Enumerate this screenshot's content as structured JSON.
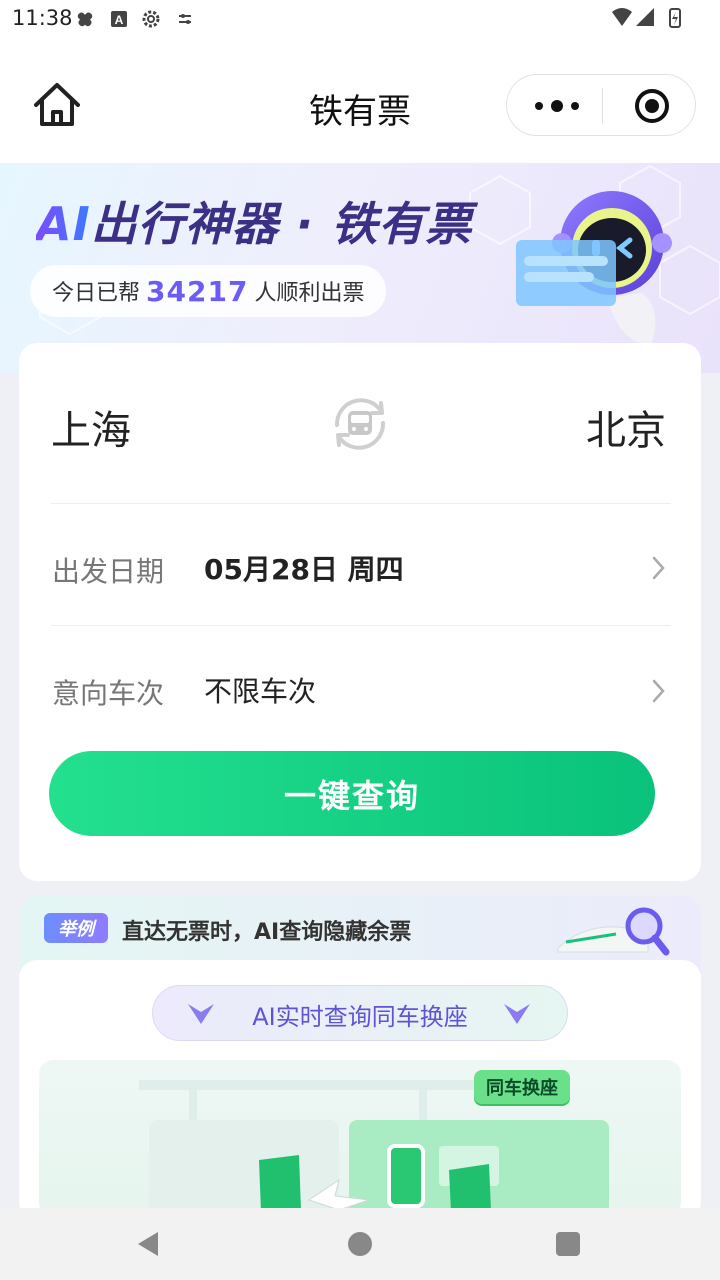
{
  "status_bar": {
    "time": "11:38"
  },
  "nav": {
    "title": "铁有票"
  },
  "hero": {
    "title_ai": "AI",
    "title_rest": "出行神器 · 铁有票",
    "pill_prefix": "今日已帮",
    "pill_count": "34217",
    "pill_suffix": "人顺利出票"
  },
  "search": {
    "from_city": "上海",
    "to_city": "北京",
    "date_label": "出发日期",
    "date_value": "05月28日 周四",
    "train_label": "意向车次",
    "train_value": "不限车次",
    "query_button": "一键查询"
  },
  "example": {
    "tag": "举例",
    "text": "直达无票时，AI查询隐藏余票",
    "subtitle": "AI实时查询同车换座",
    "illus_tag": "同车换座"
  },
  "colors": {
    "accent_green": "#0ac27b",
    "accent_purple": "#6a5cf4"
  },
  "icons": {
    "home": "home-icon",
    "more": "more-dots-icon",
    "close": "target-circle-icon",
    "swap": "train-swap-icon",
    "chevron": "chevron-right-icon"
  }
}
